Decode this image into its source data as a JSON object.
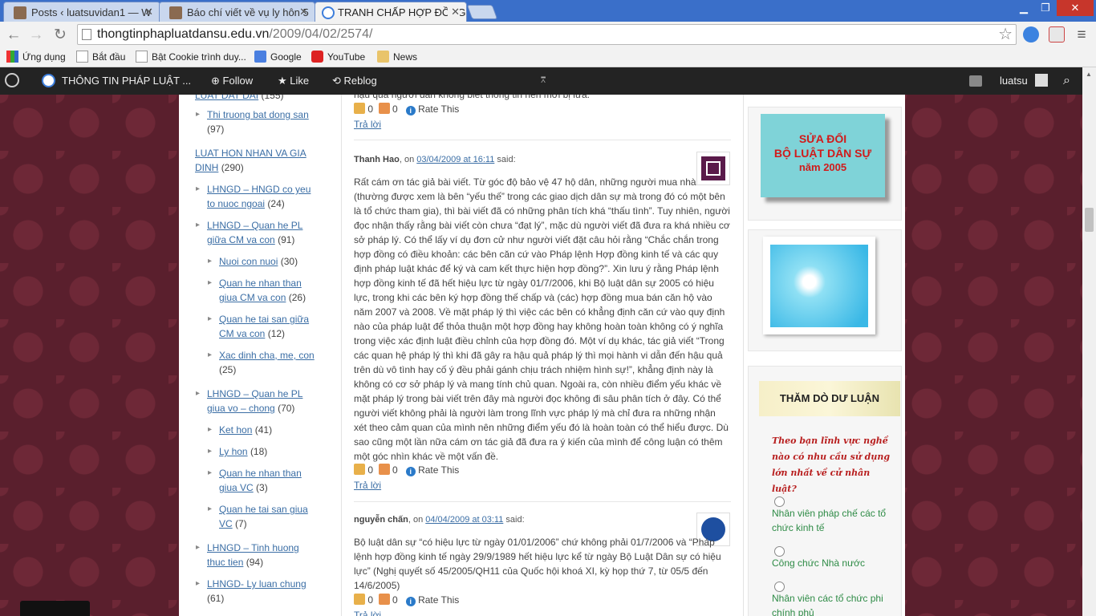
{
  "browser": {
    "tabs": [
      {
        "title": "Posts ‹ luatsuvidan1 — W",
        "active": false
      },
      {
        "title": "Báo chí viết về vụ ly hôn 5",
        "active": false
      },
      {
        "title": "TRANH CHẤP HỢP ĐỒNG",
        "active": true
      }
    ],
    "url_domain": "thongtinphapluatdansu.edu.vn",
    "url_path": "/2009/04/02/2574/",
    "bookmarks": [
      "Ứng dụng",
      "Bắt đầu",
      "Bật Cookie trình duy...",
      "Google",
      "YouTube",
      "News"
    ]
  },
  "wpbar": {
    "site_title": "THÔNG TIN PHÁP LUẬT ...",
    "follow": "Follow",
    "like": "Like",
    "reblog": "Reblog",
    "user": "luatsu"
  },
  "left_categories": [
    {
      "label": "LUAT DAT DAI",
      "count": "(155)",
      "level": 0
    },
    {
      "label": "Thi truong bat dong san",
      "count": "(97)",
      "level": 1
    },
    {
      "label": "LUAT HON NHAN VA GIA DINH",
      "count": "(290)",
      "level": 0
    },
    {
      "label": "LHNGD – HNGD co yeu to nuoc ngoai",
      "count": "(24)",
      "level": 1
    },
    {
      "label": "LHNGD – Quan he PL giữa CM va con",
      "count": "(91)",
      "level": 1
    },
    {
      "label": "Nuoi con nuoi",
      "count": "(30)",
      "level": 2
    },
    {
      "label": "Quan he nhan than giua CM va con",
      "count": "(26)",
      "level": 2
    },
    {
      "label": "Quan he tai san giữa CM va con",
      "count": "(12)",
      "level": 2
    },
    {
      "label": "Xac dinh cha, me, con",
      "count": "(25)",
      "level": 2
    },
    {
      "label": "LHNGD – Quan he PL giua vo – chong",
      "count": "(70)",
      "level": 1
    },
    {
      "label": "Ket hon",
      "count": "(41)",
      "level": 2
    },
    {
      "label": "Ly hon",
      "count": "(18)",
      "level": 2
    },
    {
      "label": "Quan he nhan than giua VC",
      "count": "(3)",
      "level": 2
    },
    {
      "label": "Quan he tai san giua VC",
      "count": "(7)",
      "level": 2
    },
    {
      "label": "LHNGD – Tinh huong thuc tien",
      "count": "(94)",
      "level": 1
    },
    {
      "label": "LHNGD- Ly luan chung",
      "count": "(61)",
      "level": 1
    }
  ],
  "comments": {
    "top_fragment": "hậu quả người dân không biết thông tin nên mới bị lừa.",
    "rate_this": "Rate This",
    "reply": "Trả lời",
    "zero": "0",
    "said": "said:",
    "on": ", on",
    "c1_author": "Thanh Hao",
    "c1_date": "03/04/2009 at 16:11",
    "c1_text": "Rất cám ơn tác giả bài viết. Từ góc độ bảo vệ 47 hộ dân, những người mua nhà (thường được xem là bên “yếu thế” trong các giao dịch dân sự mà trong đó có một bên là tổ chức tham gia), thì bài viết đã có những phân tích khá “thấu tình”. Tuy nhiên, người đọc nhận thấy rằng bài viết còn chưa “đạt lý”, mặc dù người viết đã đưa ra khá nhiều cơ sở pháp lý. Có thể lấy ví dụ đơn cử như người viết đặt câu hỏi rằng “Chắc chắn trong hợp đồng có điều khoản: các bên căn cứ vào Pháp lệnh Hợp đồng kinh tế và các quy định pháp luật khác để ký và cam kết thực hiện hợp đồng?”. Xin lưu ý rằng Pháp lệnh hợp đồng kinh tế đã hết hiệu lực từ ngày 01/7/2006, khi Bộ luật dân sự 2005 có hiệu lực, trong khi các bên ký hợp đồng thế chấp và (các) hợp đồng mua bán căn hộ vào năm 2007 và 2008. Về mặt pháp lý thì việc các bên có khẳng định căn cứ vào quy định nào của pháp luật để thỏa thuận một hợp đồng hay không hoàn toàn không có ý nghĩa trong việc xác định luật điều chỉnh của hợp đồng đó. Một ví dụ khác, tác giả viết “Trong các quan hệ pháp lý thì khi đã gây ra hậu quả pháp lý thì mọi hành vi dẫn đến hậu quả trên dù vô tình hay cố ý đều phải gánh chịu trách nhiệm hình sự!”, khẳng định này là không có cơ sở pháp lý và mang tính chủ quan. Ngoài ra, còn nhiều điểm yếu khác về mặt pháp lý trong bài viết trên đây mà người đọc không đi sâu phân tích ở đây. Có thể người viết không phải là người làm trong lĩnh vực pháp lý mà chỉ đưa ra những nhận xét theo cảm quan của mình nên những điểm yếu đó là hoàn toàn có thể hiểu được. Dù sao cũng một lần nữa cám ơn tác giả đã đưa ra ý kiến của mình để công luận có thêm một góc nhìn khác về một vấn đề.",
    "c2_author": "nguyễn chấn",
    "c2_date": "04/04/2009 at 03:11",
    "c2_text": "Bộ luật dân sự “có hiệu lực từ ngày 01/01/2006” chứ không phải 01/7/2006 và “Pháp lệnh hợp đồng kinh tế ngày 29/9/1989 hết hiệu lực kể từ ngày Bộ Luật Dân sự có hiệu lực” (Nghị quyết số 45/2005/QH11 của Quốc hội khoá XI, kỳ họp thứ 7, từ 05/5 đến 14/6/2005)"
  },
  "sidebar": {
    "banner1_lines": [
      "SỬA ĐỔI",
      "BỘ LUẬT DÂN SỰ",
      "năm 2005"
    ],
    "banner2_title": "THĂM DÒ DƯ LUẬN",
    "poll_question": "Theo bạn lĩnh vực nghề nào có nhu cầu sử dụng lớn nhất về cử nhân luật?",
    "poll_options": [
      "Nhân viên pháp chế các tổ chức kinh tế",
      "Công chức Nhà nước",
      "Nhân viên các tổ chức phi chính phủ"
    ]
  }
}
